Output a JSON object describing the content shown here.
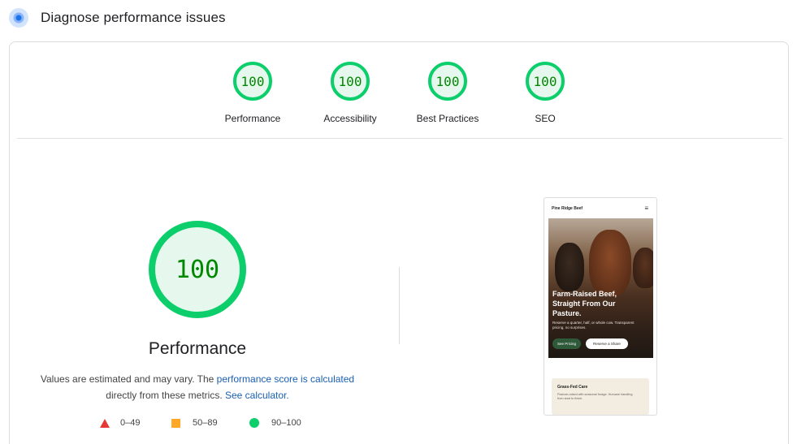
{
  "header": {
    "title": "Diagnose performance issues",
    "icon": "lighthouse-icon"
  },
  "summary_scores": [
    {
      "label": "Performance",
      "score": "100"
    },
    {
      "label": "Accessibility",
      "score": "100"
    },
    {
      "label": "Best Practices",
      "score": "100"
    },
    {
      "label": "SEO",
      "score": "100"
    }
  ],
  "main": {
    "score": "100",
    "label": "Performance",
    "desc_part1": "Values are estimated and may vary. The ",
    "desc_link1": "performance score is calculated",
    "desc_part2": "directly from these metrics. ",
    "desc_link2": "See calculator."
  },
  "legend": [
    {
      "range": "0–49",
      "color": "#e53935"
    },
    {
      "range": "50–89",
      "color": "#ffa726"
    },
    {
      "range": "90–100",
      "color": "#0cce6b"
    }
  ],
  "screenshot": {
    "brand": "Pine Ridge Beef",
    "menu_icon": "hamburger-icon",
    "headline": "Farm-Raised Beef, Straight From Our Pasture.",
    "subhead": "Reserve a quarter, half, or whole cow. Transparent pricing, no surprises.",
    "button_primary": "See Pricing",
    "button_secondary": "Reserve a Share",
    "card_title": "Grass-Fed Care",
    "card_text": "Pasture-raised with seasonal forage. Humane handling from start to finish."
  },
  "colors": {
    "pass": "#0cce6b",
    "pass_text": "#008800",
    "average": "#ffa726",
    "fail": "#e53935",
    "link": "#1a5fb4"
  }
}
